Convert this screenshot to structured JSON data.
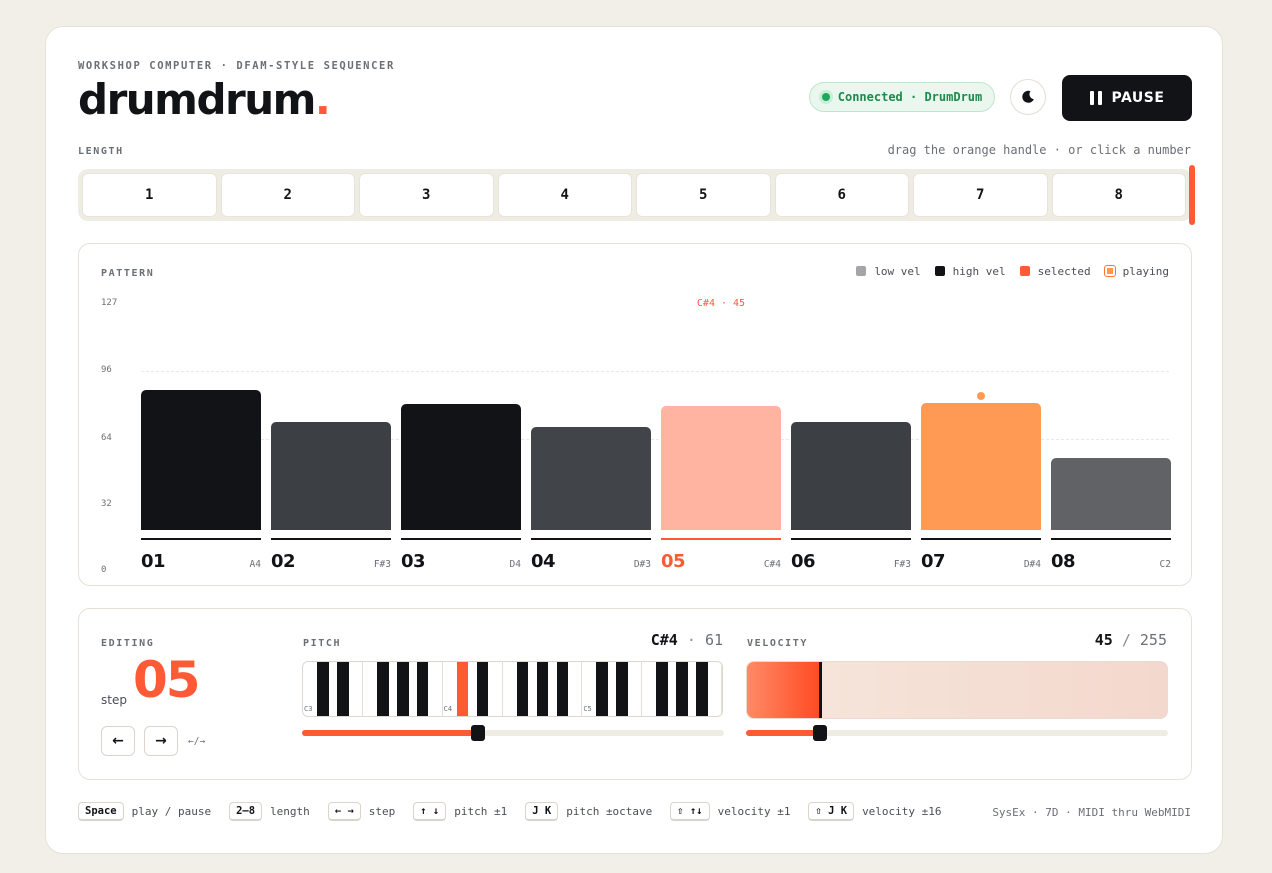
{
  "header": {
    "eyebrow": "WORKSHOP COMPUTER · DFAM-STYLE SEQUENCER",
    "logo_text": "drumdrum",
    "logo_dot": ".",
    "connection": "Connected · DrumDrum",
    "theme_icon": "moon-icon",
    "pause_label": "PAUSE"
  },
  "length": {
    "label": "LENGTH",
    "hint": "drag the orange handle · or click a number",
    "options": [
      "1",
      "2",
      "3",
      "4",
      "5",
      "6",
      "7",
      "8"
    ],
    "selected": 8
  },
  "pattern": {
    "label": "PATTERN",
    "legend": {
      "low": "low vel",
      "high": "high vel",
      "selected": "selected",
      "playing": "playing"
    },
    "selected_annotation": "C#4 · 45",
    "steps": [
      {
        "num": "01",
        "note": "A4"
      },
      {
        "num": "02",
        "note": "F#3"
      },
      {
        "num": "03",
        "note": "D4"
      },
      {
        "num": "04",
        "note": "D#3"
      },
      {
        "num": "05",
        "note": "C#4"
      },
      {
        "num": "06",
        "note": "F#3"
      },
      {
        "num": "07",
        "note": "D#4"
      },
      {
        "num": "08",
        "note": "C2"
      }
    ]
  },
  "chart_data": {
    "type": "bar",
    "categories": [
      "01",
      "02",
      "03",
      "04",
      "05",
      "06",
      "07",
      "08"
    ],
    "values": [
      80,
      62,
      72,
      59,
      71,
      62,
      73,
      41
    ],
    "ylim": [
      0,
      127
    ],
    "yticks": [
      "127",
      "96",
      "64",
      "32",
      "0"
    ],
    "selected_index": 4,
    "playing_index": 6,
    "colors": {
      "low": "#a3a5a8",
      "high": "#111317",
      "selected": "#ff5a36",
      "playing": "#ff9a55"
    }
  },
  "editing": {
    "label": "EDITING",
    "step_word": "step",
    "step_value": "05",
    "prev_label": "←",
    "next_label": "→",
    "nav_hint": "←/→"
  },
  "pitch": {
    "label": "PITCH",
    "note": "C#4",
    "sep": "·",
    "midi": "61",
    "octave_labels": [
      "C3",
      "C4",
      "C5"
    ],
    "range": [
      48,
      83
    ],
    "value": 61
  },
  "velocity": {
    "label": "VELOCITY",
    "value": "45",
    "sep": "/",
    "max": "255",
    "fraction": 0.176
  },
  "shortcuts": [
    {
      "key": "Space",
      "desc": "play / pause"
    },
    {
      "key": "2–8",
      "desc": "length"
    },
    {
      "key": "← →",
      "desc": "step"
    },
    {
      "key": "↑ ↓",
      "desc": "pitch ±1"
    },
    {
      "key": "J K",
      "desc": "pitch ±octave"
    },
    {
      "key": "⇧ ↑↓",
      "desc": "velocity ±1"
    },
    {
      "key": "⇧ J K",
      "desc": "velocity ±16"
    }
  ],
  "footer_note": "SysEx · 7D · MIDI thru WebMIDI"
}
